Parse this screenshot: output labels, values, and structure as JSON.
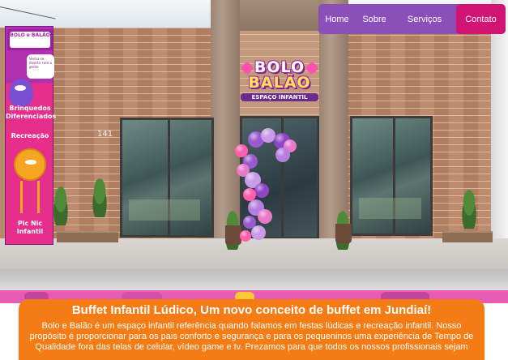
{
  "nav": {
    "items": [
      {
        "label": "Home"
      },
      {
        "label": "Sobre"
      },
      {
        "label": "Serviços"
      },
      {
        "label": "Contato"
      }
    ],
    "active_color": "#d11373",
    "bar_color": "#8a4fb9"
  },
  "hero": {
    "storefront_logo": {
      "line1": "BOLO",
      "line2": "BALÃO",
      "subtitle": "ESPAÇO INFANTIL"
    },
    "house_number": "141",
    "banner": {
      "logo_text": "BOLO e BALÃO",
      "bubble_text": "Venha se divertir com a gente",
      "item1": "Brinquedos Diferenciados",
      "item2": "Recreação",
      "item3": "Pic Nic Infantil"
    }
  },
  "intro": {
    "title": "Buffet Infantil Lúdico, Um novo conceito de buffet em Jundiaí!",
    "body": "Bolo e Balão é um espaço infantil referência quando falamos em festas lúdicas e recreação infantil. Nosso propósito é proporcionar para os pais conforto e segurança e para os pequeninos uma experiência de Tempo de Qualidade fora das telas de celular, vídeo game e tv. Prezamos para que todos os nossos profissionais sejam",
    "panel_color": "#f57b14",
    "stripe_color": "#e85bb4"
  }
}
